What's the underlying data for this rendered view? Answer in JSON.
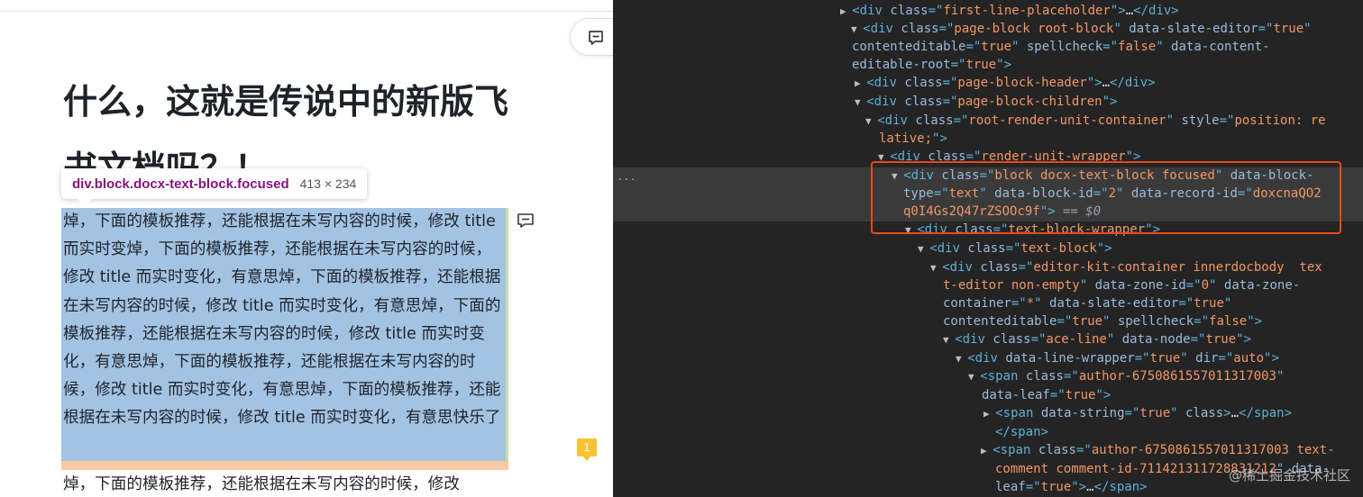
{
  "document": {
    "title": "什么，这就是传说中的新版飞书文档吗？！",
    "inspect_tooltip": {
      "tag": "div.block.docx-text-block.focused",
      "size": "413 × 234"
    },
    "selected_block_text": "焯，下面的模板推荐，还能根据在未写内容的时候，修改 title 而实时变焯，下面的模板推荐，还能根据在未写内容的时候，修改 title 而实时变化，有意思焯，下面的模板推荐，还能根据在未写内容的时候，修改 title 而实时变化，有意思焯，下面的模板推荐，还能根据在未写内容的时候，修改 title 而实时变化，有意思焯，下面的模板推荐，还能根据在未写内容的时候，修改 title 而实时变化，有意思焯，下面的模板推荐，还能根据在未写内容的时候，修改 title 而实时变化，有意思快乐了",
    "next_paragraph": "焯，下面的模板推荐，还能根据在未写内容的时候，修改",
    "comment_count": "1"
  },
  "devtools": {
    "hover_ellipsis": "...",
    "dollar_ref": "== $0",
    "watermark": "@稀土掘金技术社区",
    "lines": [
      [
        [
          "tri",
          "▶ "
        ],
        [
          "tg",
          "<div "
        ],
        [
          "an",
          "class"
        ],
        [
          "tg",
          "=\""
        ],
        [
          "av",
          "first-line-placeholder"
        ],
        [
          "tg",
          "\">"
        ],
        [
          "tx",
          "…"
        ],
        [
          "tg",
          "</div>"
        ]
      ],
      [
        [
          "tri",
          "▼ "
        ],
        [
          "tg",
          "<div "
        ],
        [
          "an",
          "class"
        ],
        [
          "tg",
          "=\""
        ],
        [
          "av",
          "page-block root-block"
        ],
        [
          "tg",
          "\" "
        ],
        [
          "an",
          "data-slate-editor"
        ],
        [
          "tg",
          "=\""
        ],
        [
          "av",
          "true"
        ],
        [
          "tg",
          "\""
        ]
      ],
      [
        [
          "an",
          "contenteditable"
        ],
        [
          "tg",
          "=\""
        ],
        [
          "av",
          "true"
        ],
        [
          "tg",
          "\" "
        ],
        [
          "an",
          "spellcheck"
        ],
        [
          "tg",
          "=\""
        ],
        [
          "av",
          "false"
        ],
        [
          "tg",
          "\" "
        ],
        [
          "an",
          "data-content-"
        ]
      ],
      [
        [
          "an",
          "editable-root"
        ],
        [
          "tg",
          "=\""
        ],
        [
          "av",
          "true"
        ],
        [
          "tg",
          "\">"
        ]
      ],
      [
        [
          "tri",
          "▶ "
        ],
        [
          "tg",
          "<div "
        ],
        [
          "an",
          "class"
        ],
        [
          "tg",
          "=\""
        ],
        [
          "av",
          "page-block-header"
        ],
        [
          "tg",
          "\">"
        ],
        [
          "tx",
          "…"
        ],
        [
          "tg",
          "</div>"
        ]
      ],
      [
        [
          "tri",
          "▼ "
        ],
        [
          "tg",
          "<div "
        ],
        [
          "an",
          "class"
        ],
        [
          "tg",
          "=\""
        ],
        [
          "av",
          "page-block-children"
        ],
        [
          "tg",
          "\">"
        ]
      ],
      [
        [
          "tri",
          "▼ "
        ],
        [
          "tg",
          "<div "
        ],
        [
          "an",
          "class"
        ],
        [
          "tg",
          "=\""
        ],
        [
          "av",
          "root-render-unit-container"
        ],
        [
          "tg",
          "\" "
        ],
        [
          "an",
          "style"
        ],
        [
          "tg",
          "=\""
        ],
        [
          "av",
          "position: re"
        ]
      ],
      [
        [
          "av",
          "lative;"
        ],
        [
          "tg",
          "\">"
        ]
      ],
      [
        [
          "tri",
          "▼ "
        ],
        [
          "tg",
          "<div "
        ],
        [
          "an",
          "class"
        ],
        [
          "tg",
          "=\""
        ],
        [
          "av",
          "render-unit-wrapper"
        ],
        [
          "tg",
          "\">"
        ]
      ],
      [
        [
          "tri",
          "▼ "
        ],
        [
          "tg",
          "<div "
        ],
        [
          "an",
          "class"
        ],
        [
          "tg",
          "=\""
        ],
        [
          "av",
          "block docx-text-block focused"
        ],
        [
          "tg",
          "\" "
        ],
        [
          "an",
          "data-block-"
        ]
      ],
      [
        [
          "an",
          "type"
        ],
        [
          "tg",
          "=\""
        ],
        [
          "av",
          "text"
        ],
        [
          "tg",
          "\" "
        ],
        [
          "an",
          "data-block-id"
        ],
        [
          "tg",
          "=\""
        ],
        [
          "av",
          "2"
        ],
        [
          "tg",
          "\" "
        ],
        [
          "an",
          "data-record-id"
        ],
        [
          "tg",
          "=\""
        ],
        [
          "av",
          "doxcnaQO2"
        ]
      ],
      [
        [
          "av",
          "q0I4Gs2Q47rZSOOc9f"
        ],
        [
          "tg",
          "\">"
        ]
      ],
      [
        [
          "tri",
          "▼ "
        ],
        [
          "tg",
          "<div "
        ],
        [
          "an",
          "class"
        ],
        [
          "tg",
          "=\""
        ],
        [
          "av",
          "text-block-wrapper"
        ],
        [
          "tg",
          "\">"
        ]
      ],
      [
        [
          "tri",
          "▼ "
        ],
        [
          "tg",
          "<div "
        ],
        [
          "an",
          "class"
        ],
        [
          "tg",
          "=\""
        ],
        [
          "av",
          "text-block"
        ],
        [
          "tg",
          "\">"
        ]
      ],
      [
        [
          "tri",
          "▼ "
        ],
        [
          "tg",
          "<div "
        ],
        [
          "an",
          "class"
        ],
        [
          "tg",
          "=\""
        ],
        [
          "av",
          "editor-kit-container innerdocbody  tex"
        ]
      ],
      [
        [
          "av",
          "t-editor non-empty"
        ],
        [
          "tg",
          "\" "
        ],
        [
          "an",
          "data-zone-id"
        ],
        [
          "tg",
          "=\""
        ],
        [
          "av",
          "0"
        ],
        [
          "tg",
          "\" "
        ],
        [
          "an",
          "data-zone-"
        ]
      ],
      [
        [
          "an",
          "container"
        ],
        [
          "tg",
          "=\""
        ],
        [
          "av",
          "*"
        ],
        [
          "tg",
          "\" "
        ],
        [
          "an",
          "data-slate-editor"
        ],
        [
          "tg",
          "=\""
        ],
        [
          "av",
          "true"
        ],
        [
          "tg",
          "\""
        ]
      ],
      [
        [
          "an",
          "contenteditable"
        ],
        [
          "tg",
          "=\""
        ],
        [
          "av",
          "true"
        ],
        [
          "tg",
          "\" "
        ],
        [
          "an",
          "spellcheck"
        ],
        [
          "tg",
          "=\""
        ],
        [
          "av",
          "false"
        ],
        [
          "tg",
          "\">"
        ]
      ],
      [
        [
          "tri",
          "▼ "
        ],
        [
          "tg",
          "<div "
        ],
        [
          "an",
          "class"
        ],
        [
          "tg",
          "=\""
        ],
        [
          "av",
          "ace-line"
        ],
        [
          "tg",
          "\" "
        ],
        [
          "an",
          "data-node"
        ],
        [
          "tg",
          "=\""
        ],
        [
          "av",
          "true"
        ],
        [
          "tg",
          "\">"
        ]
      ],
      [
        [
          "tri",
          "▼ "
        ],
        [
          "tg",
          "<div "
        ],
        [
          "an",
          "data-line-wrapper"
        ],
        [
          "tg",
          "=\""
        ],
        [
          "av",
          "true"
        ],
        [
          "tg",
          "\" "
        ],
        [
          "an",
          "dir"
        ],
        [
          "tg",
          "=\""
        ],
        [
          "av",
          "auto"
        ],
        [
          "tg",
          "\">"
        ]
      ],
      [
        [
          "tri",
          "▼ "
        ],
        [
          "tg",
          "<span "
        ],
        [
          "an",
          "class"
        ],
        [
          "tg",
          "=\""
        ],
        [
          "av",
          "author-6750861557011317003"
        ],
        [
          "tg",
          "\""
        ]
      ],
      [
        [
          "an",
          "data-leaf"
        ],
        [
          "tg",
          "=\""
        ],
        [
          "av",
          "true"
        ],
        [
          "tg",
          "\">"
        ]
      ],
      [
        [
          "tri",
          "▶ "
        ],
        [
          "tg",
          "<span "
        ],
        [
          "an",
          "data-string"
        ],
        [
          "tg",
          "=\""
        ],
        [
          "av",
          "true"
        ],
        [
          "tg",
          "\" "
        ],
        [
          "an",
          "class"
        ],
        [
          "tg",
          ">"
        ],
        [
          "tx",
          "…"
        ],
        [
          "tg",
          "</span>"
        ]
      ],
      [
        [
          "tg",
          "</span>"
        ]
      ],
      [
        [
          "tri",
          "▶ "
        ],
        [
          "tg",
          "<span "
        ],
        [
          "an",
          "class"
        ],
        [
          "tg",
          "=\""
        ],
        [
          "av",
          "author-6750861557011317003 text-"
        ]
      ],
      [
        [
          "av",
          "comment comment-id-711421311728831212"
        ],
        [
          "tg",
          "\" "
        ],
        [
          "an",
          "data-"
        ]
      ],
      [
        [
          "an",
          "leaf"
        ],
        [
          "tg",
          "=\""
        ],
        [
          "av",
          "true"
        ],
        [
          "tg",
          "\">"
        ],
        [
          "tx",
          "…"
        ],
        [
          "tg",
          "</span>"
        ]
      ]
    ]
  }
}
